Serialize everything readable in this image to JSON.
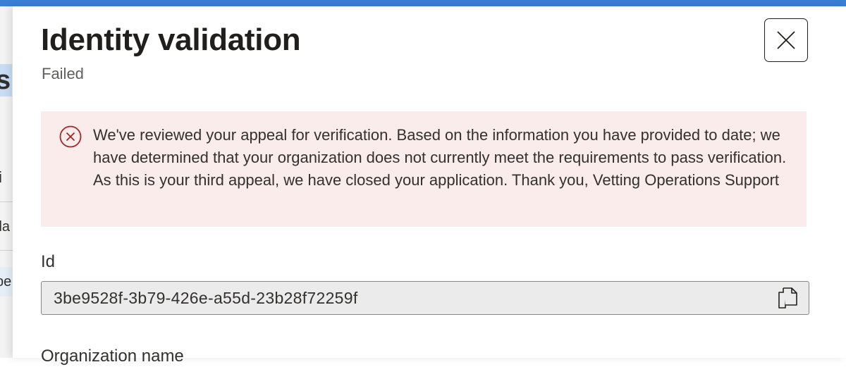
{
  "background": {
    "fragment_heading": "s",
    "fragment_1": "ti",
    "fragment_2": "ila",
    "fragment_3": "pe"
  },
  "dialog": {
    "title": "Identity validation",
    "status": "Failed",
    "close_icon": "close-icon",
    "error": {
      "icon": "error-circle-icon",
      "message": "We've reviewed your appeal for verification. Based on the information you have provided to date; we have determined that your organization does not currently meet the requirements to pass verification. As this is your third appeal, we have closed your application. Thank you, Vetting Operations Support"
    },
    "fields": {
      "id_label": "Id",
      "id_value": "3be9528f-3b79-426e-a55d-23b28f72259f",
      "copy_icon": "copy-icon",
      "org_label": "Organization name"
    }
  },
  "colors": {
    "accent_bar": "#3a7fd5",
    "error_background": "#f9ecea",
    "error_icon": "#a4262c",
    "field_background": "#ebebeb"
  }
}
